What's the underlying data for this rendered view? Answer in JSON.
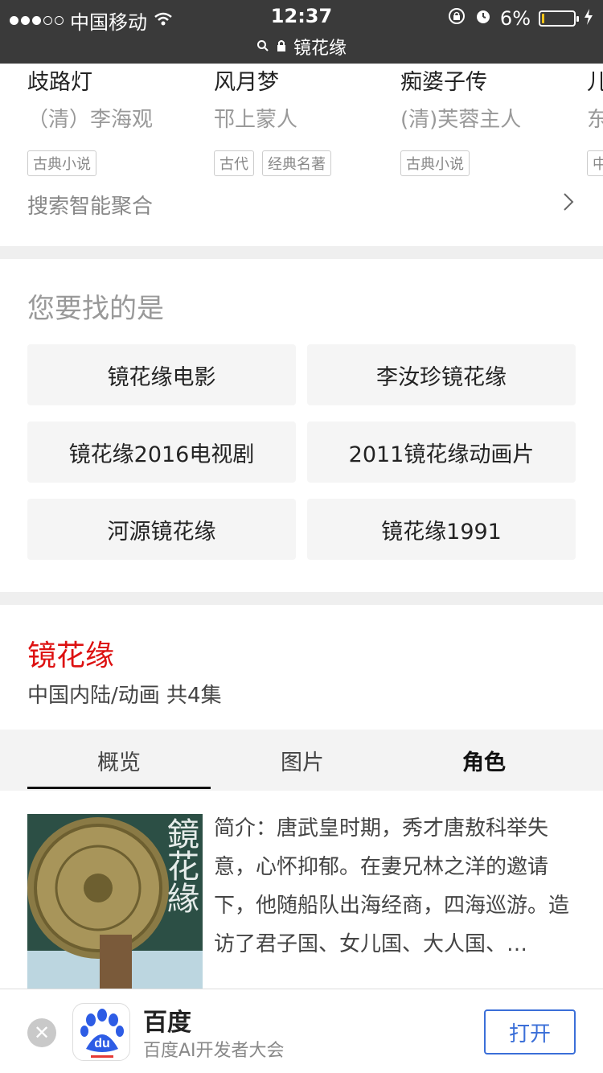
{
  "status_bar": {
    "carrier": "中国移动",
    "time": "12:37",
    "url": "镜花缘",
    "battery": "6%",
    "battery_level": 0.06,
    "icons": [
      "signal-dots-icon",
      "wifi-icon",
      "search-icon",
      "lock-icon",
      "rotation-lock-icon",
      "alarm-icon",
      "battery-icon",
      "charging-bolt-icon"
    ]
  },
  "books": [
    {
      "title": "歧路灯",
      "author": "（清）李海观",
      "tags": [
        "古典小说"
      ]
    },
    {
      "title": "风月梦",
      "author": "邗上蒙人",
      "tags": [
        "古代",
        "经典名著"
      ]
    },
    {
      "title": "痴婆子传",
      "author": "(清)芙蓉主人",
      "tags": [
        "古典小说"
      ]
    },
    {
      "title": "儿",
      "author": "东",
      "tags": [
        "中"
      ]
    }
  ],
  "aggregate": {
    "label": "搜索智能聚合"
  },
  "suggest": {
    "title": "您要找的是",
    "items": [
      "镜花缘电影",
      "李汝珍镜花缘",
      "镜花缘2016电视剧",
      "2011镜花缘动画片",
      "河源镜花缘",
      "镜花缘1991"
    ]
  },
  "result": {
    "title": "镜花缘",
    "meta": "中国内陆/动画  共4集",
    "tabs": [
      "概览",
      "图片",
      "角色"
    ],
    "active_tab": "概览",
    "intro": "简介：唐武皇时期，秀才唐敖科举失意，心怀抑郁。在妻兄林之洋的邀请下，他随船队出海经商，四海巡游。造访了君子国、女儿国、大人国、…",
    "poster_text": "鏡花緣"
  },
  "banner": {
    "app_name": "百度",
    "subtitle": "百度AI开发者大会",
    "icon_text": "du",
    "open_label": "打开",
    "close_symbol": "✕"
  },
  "colors": {
    "accent_red": "#d11111",
    "link_blue": "#3b6fd8",
    "status_bg": "#3a3a3a",
    "battery_yellow": "#f5c518"
  }
}
